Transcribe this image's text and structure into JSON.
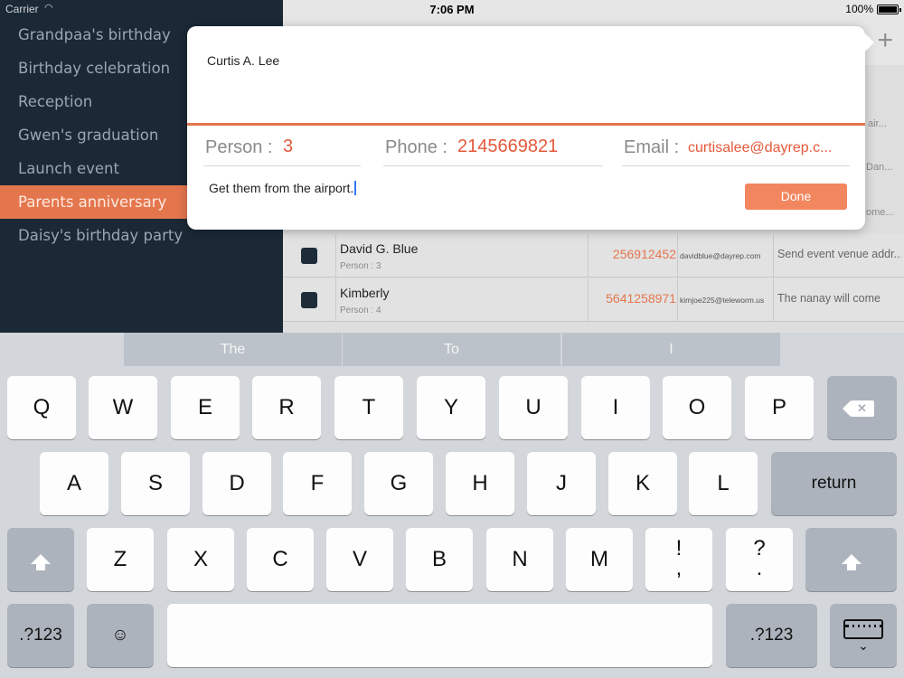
{
  "status_bar": {
    "carrier": "Carrier",
    "wifi_icon": "wifi-icon",
    "time": "7:06 PM",
    "battery": "100%"
  },
  "sidebar": {
    "items": [
      {
        "label": "Grandpaa's birthday",
        "active": false
      },
      {
        "label": "Birthday celebration",
        "active": false
      },
      {
        "label": "Reception",
        "active": false
      },
      {
        "label": "Gwen's graduation",
        "active": false
      },
      {
        "label": "Launch event",
        "active": false
      },
      {
        "label": "Parents anniversary",
        "active": true
      },
      {
        "label": "Daisy's birthday party",
        "active": false
      }
    ]
  },
  "table": {
    "add_icon": "plus-icon",
    "add_label": "+",
    "peek": {
      "note1": "air...",
      "note2": "Dan...",
      "note3": "ome..."
    },
    "rows": [
      {
        "name": "David G. Blue",
        "person": "Person : 3",
        "phone": "256912452",
        "email": "davidblue@dayrep.com",
        "note": "Send event venue addr..."
      },
      {
        "name": "Kimberly",
        "person": "Person : 4",
        "phone": "5641258971",
        "email": "kimjoe225@teleworm.us",
        "note": "The nanay will come"
      }
    ]
  },
  "popover": {
    "name": "Curtis A. Lee",
    "person_label": "Person :",
    "person_value": "3",
    "phone_label": "Phone :",
    "phone_value": "2145669821",
    "email_label": "Email :",
    "email_value": "curtisalee@dayrep.c...",
    "note": "Get them from the airport.",
    "done_label": "Done"
  },
  "keyboard": {
    "suggestions": [
      "The",
      "To",
      "I"
    ],
    "row1": [
      "Q",
      "W",
      "E",
      "R",
      "T",
      "Y",
      "U",
      "I",
      "O",
      "P"
    ],
    "row2": [
      "A",
      "S",
      "D",
      "F",
      "G",
      "H",
      "J",
      "K",
      "L"
    ],
    "row3": [
      "Z",
      "X",
      "C",
      "V",
      "B",
      "N",
      "M"
    ],
    "exclaim_top": "!",
    "exclaim_bottom": ",",
    "question_top": "?",
    "question_bottom": ".",
    "return_label": "return",
    "numbers_label": ".?123",
    "emoji_label": "☺",
    "backspace_icon": "backspace-icon",
    "shift_icon": "shift-icon",
    "hide_keyboard_icon": "keyboard-hide-icon"
  },
  "colors": {
    "accent": "#e4764e",
    "sidebar_bg": "#1b2835",
    "value_red": "#e4593a"
  }
}
